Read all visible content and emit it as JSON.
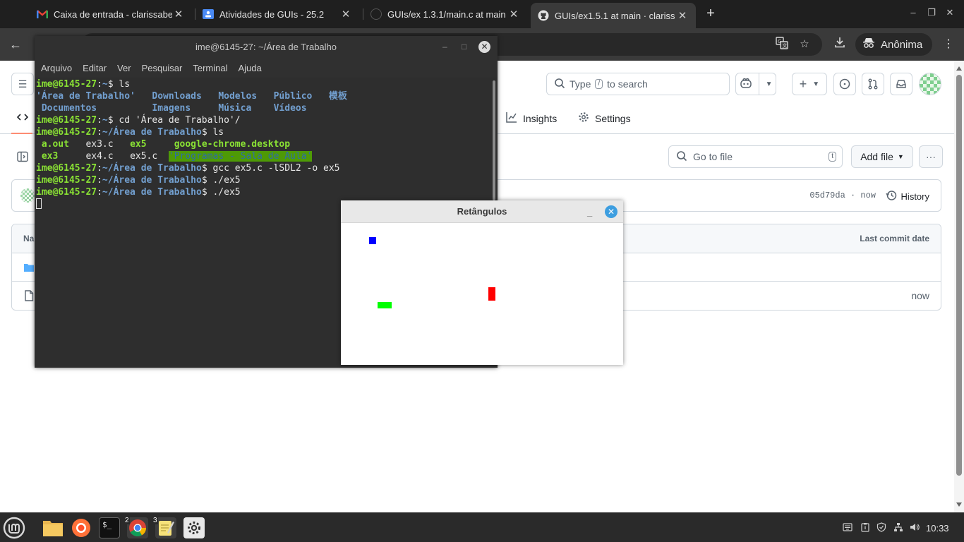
{
  "browser": {
    "tabs": [
      {
        "title": "Caixa de entrada - clarissabe",
        "favicon": "gmail-icon",
        "active": false
      },
      {
        "title": "Atividades de GUIs - 25.2",
        "favicon": "classroom-icon",
        "active": false
      },
      {
        "title": "GUIs/ex 1.3.1/main.c at main",
        "favicon": "github-icon",
        "active": false
      },
      {
        "title": "GUIs/ex1.5.1 at main · clariss",
        "favicon": "github-icon",
        "active": true
      }
    ],
    "new_tab": "+",
    "profile_label": "Anônima",
    "accent": "#3a3a3a"
  },
  "github": {
    "search_placeholder_pre": "Type",
    "search_key": "/",
    "search_placeholder_post": "to search",
    "nav": {
      "insights": "Insights",
      "settings": "Settings"
    },
    "goto_file_placeholder": "Go to file",
    "goto_file_key": "t",
    "add_file_label": "Add file",
    "commit_hash": "05d79da · now",
    "history_label": "History",
    "table": {
      "name_header": "Na",
      "date_header": "Last commit date",
      "rows": [
        {
          "type": "folder",
          "date": ""
        },
        {
          "type": "file",
          "date": "now"
        }
      ]
    }
  },
  "terminal": {
    "title": "ime@6145-27: ~/Área de Trabalho",
    "menu": [
      "Arquivo",
      "Editar",
      "Ver",
      "Pesquisar",
      "Terminal",
      "Ajuda"
    ],
    "prompt_user": "ime@6145-27",
    "home_path": "~",
    "desktop_path": "~/Área de Trabalho",
    "lines": {
      "cmd1": "$ ls",
      "ls_home_row1": [
        "'Área de Trabalho'",
        "Downloads",
        "Modelos",
        "Público",
        "模板"
      ],
      "ls_home_row2": [
        "Documentos",
        "Imagens",
        "Música",
        "Vídeos"
      ],
      "cmd2": "$ cd 'Área de Trabalho'/",
      "cmd3": "$ ls",
      "ls_desk_row1": [
        "a.out",
        "ex3.c",
        "ex5",
        "google-chrome.desktop"
      ],
      "ls_desk_row2": [
        "ex3",
        "ex4.c",
        "ex5.c",
        "'Programas - Sala de Aula'"
      ],
      "cmd4": "$ gcc ex5.c -lSDL2 -o ex5",
      "cmd5": "$ ./ex5",
      "cmd6": "$ ./ex5"
    }
  },
  "sdl_window": {
    "title": "Retângulos",
    "colors": {
      "blue": "#0000ff",
      "green": "#00ff00",
      "red": "#ff0000"
    }
  },
  "taskbar": {
    "badges": {
      "chrome": "2",
      "editor": "3"
    },
    "clock": "10:33"
  }
}
